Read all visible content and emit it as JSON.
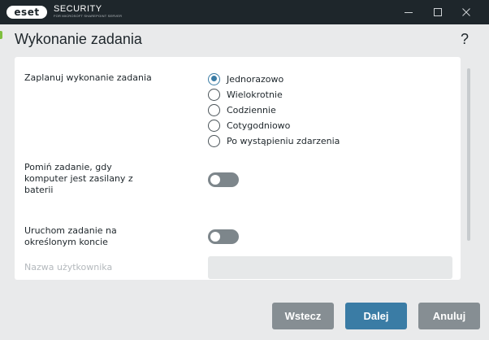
{
  "window": {
    "logo_text": "eset",
    "brand": "SECURITY",
    "brand_sub": "FOR MICROSOFT SHAREPOINT SERVER"
  },
  "page": {
    "title": "Wykonanie zadania",
    "help": "?"
  },
  "schedule": {
    "label": "Zaplanuj wykonanie zadania",
    "selected": "Jednorazowo",
    "options": [
      "Jednorazowo",
      "Wielokrotnie",
      "Codziennie",
      "Cotygodniowo",
      "Po wystąpieniu zdarzenia"
    ]
  },
  "skip_battery": {
    "label_lines": [
      "Pomiń zadanie, gdy",
      "komputer jest zasilany z",
      "baterii"
    ],
    "enabled": false
  },
  "run_as": {
    "label_lines": [
      "Uruchom zadanie na",
      "określonym koncie"
    ],
    "enabled": false
  },
  "username": {
    "label": "Nazwa użytkownika",
    "value": "",
    "disabled": true
  },
  "buttons": {
    "back": "Wstecz",
    "next": "Dalej",
    "cancel": "Anuluj"
  },
  "colors": {
    "titlebar": "#1e262b",
    "accent": "#3a7ca5",
    "button_gray": "#868e93",
    "toggle_off": "#7d868b"
  }
}
